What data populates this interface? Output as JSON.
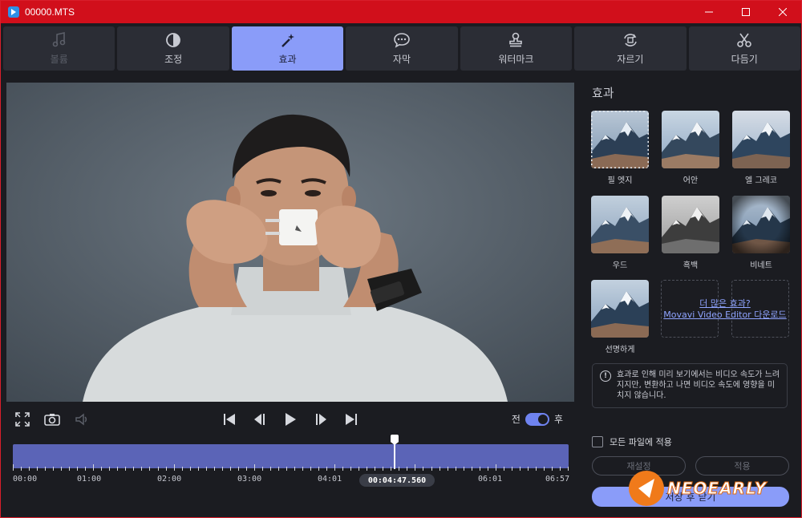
{
  "window": {
    "title": "00000.MTS"
  },
  "tabs": [
    {
      "label": "볼륨",
      "icon": "music-note-icon",
      "state": "disabled"
    },
    {
      "label": "조정",
      "icon": "contrast-icon",
      "state": "normal"
    },
    {
      "label": "효과",
      "icon": "magic-wand-icon",
      "state": "active"
    },
    {
      "label": "자막",
      "icon": "speech-bubble-icon",
      "state": "normal"
    },
    {
      "label": "워터마크",
      "icon": "stamp-icon",
      "state": "normal"
    },
    {
      "label": "자르기",
      "icon": "crop-rotate-icon",
      "state": "normal"
    },
    {
      "label": "다듬기",
      "icon": "scissors-icon",
      "state": "normal"
    }
  ],
  "player": {
    "toggle_before": "전",
    "toggle_after": "후",
    "toggle_on": true
  },
  "timeline": {
    "labels": [
      "00:00",
      "01:00",
      "02:00",
      "03:00",
      "04:01",
      "06:01",
      "06:57"
    ],
    "current_time": "00:04:47.560",
    "playhead_fraction": 0.685
  },
  "effects_panel": {
    "title": "효과",
    "effects": [
      {
        "label": "필 엣지",
        "style": "edge"
      },
      {
        "label": "어안",
        "style": "fisheye"
      },
      {
        "label": "엘 그레코",
        "style": "elgreco"
      },
      {
        "label": "우드",
        "style": "wood"
      },
      {
        "label": "흑백",
        "style": "bw"
      },
      {
        "label": "비네트",
        "style": "vignette"
      },
      {
        "label": "선명하게",
        "style": "sharpen"
      }
    ],
    "more_effects": {
      "line1": "더 많은 효과?",
      "line2": "Movavi Video Editor 다운로드"
    },
    "notice": "효과로 인해 미리 보기에서는 비디오 속도가 느려지지만, 변환하고 나면 비디오 속도에 영향을 미치지 않습니다.",
    "apply_all_label": "모든 파일에 적용",
    "reset_label": "재설정",
    "apply_label": "적용",
    "save_close_label": "저장 후 닫기"
  },
  "watermark_text": "NEOEARLY"
}
